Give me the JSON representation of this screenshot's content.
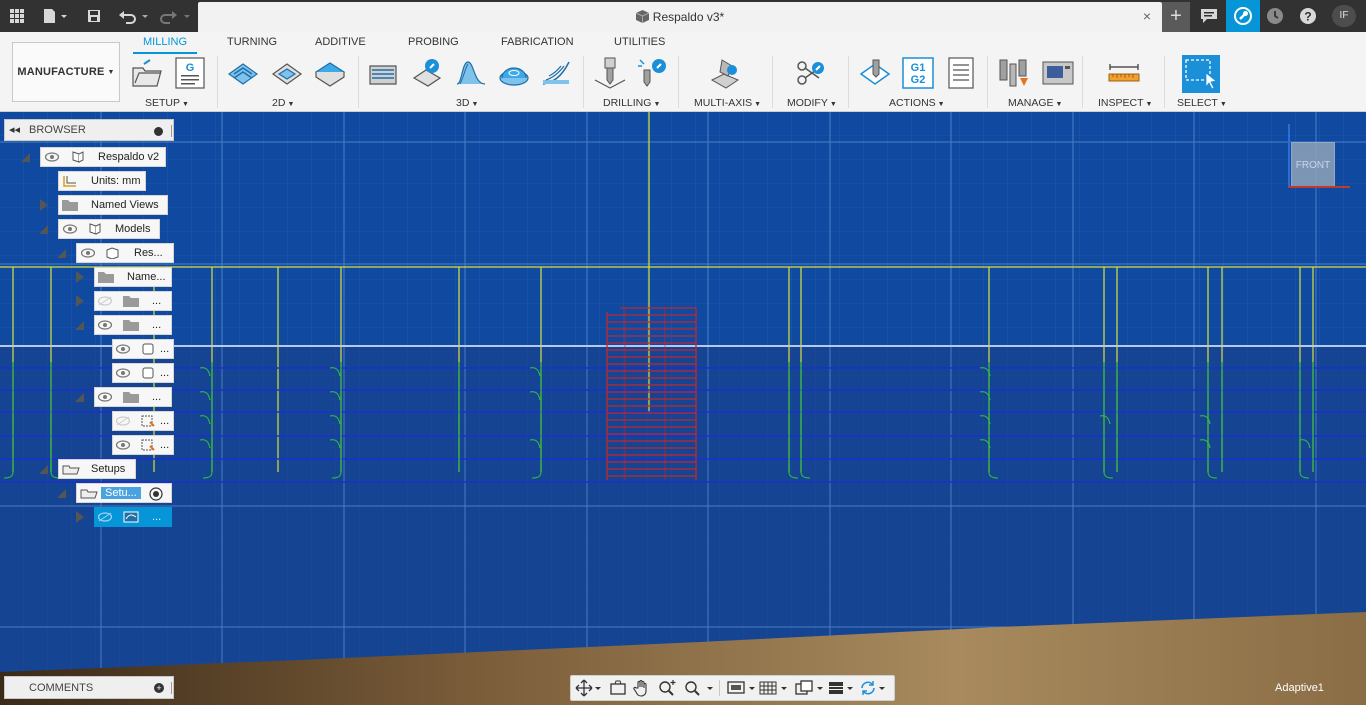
{
  "titlebar": {
    "document_title": "Respaldo v3*",
    "close_tab_glyph": "×",
    "new_tab_glyph": "+",
    "user_initials": "IF",
    "icons": [
      "app-grid-icon",
      "file-icon",
      "save-icon",
      "undo-icon",
      "redo-icon",
      "notifications-icon",
      "active-jobs-icon",
      "history-icon",
      "help-icon"
    ]
  },
  "ribbon": {
    "workspace_label": "MANUFACTURE",
    "tabs": [
      {
        "label": "MILLING",
        "active": true
      },
      {
        "label": "TURNING",
        "active": false
      },
      {
        "label": "ADDITIVE",
        "active": false
      },
      {
        "label": "PROBING",
        "active": false
      },
      {
        "label": "FABRICATION",
        "active": false
      },
      {
        "label": "UTILITIES",
        "active": false
      }
    ],
    "groups": [
      {
        "label": "SETUP",
        "icons": [
          "new-setup-icon",
          "nc-program-icon"
        ]
      },
      {
        "label": "2D",
        "icons": [
          "2d-adaptive-icon",
          "2d-pocket-icon",
          "face-icon"
        ]
      },
      {
        "label": "3D",
        "icons": [
          "3d-adaptive-icon",
          "3d-pocket-icon",
          "steep-shallow-icon",
          "scallop-icon",
          "spiral-icon"
        ]
      },
      {
        "label": "DRILLING",
        "icons": [
          "drill-icon",
          "drill-search-icon"
        ]
      },
      {
        "label": "MULTI-AXIS",
        "icons": [
          "multi-axis-icon"
        ]
      },
      {
        "label": "MODIFY",
        "icons": [
          "modify-scissors-icon"
        ]
      },
      {
        "label": "ACTIONS",
        "icons": [
          "simulate-icon",
          "post-process-icon",
          "setup-sheet-icon"
        ]
      },
      {
        "label": "MANAGE",
        "icons": [
          "tool-library-icon",
          "machine-library-icon"
        ]
      },
      {
        "label": "INSPECT",
        "icons": [
          "measure-icon"
        ]
      },
      {
        "label": "SELECT",
        "icons": [
          "select-window-icon"
        ]
      }
    ],
    "g1g2_text": [
      "G1",
      "G2"
    ],
    "nc_program_letter": "G"
  },
  "browser": {
    "header": "BROWSER",
    "nodes": [
      {
        "label": "Respaldo v2"
      },
      {
        "label": "Units: mm"
      },
      {
        "label": "Named Views"
      },
      {
        "label": "Models"
      },
      {
        "label": "Res..."
      },
      {
        "label": "Name..."
      },
      {
        "label": "..."
      },
      {
        "label": "..."
      },
      {
        "label": "..."
      },
      {
        "label": "..."
      },
      {
        "label": "..."
      },
      {
        "label": "..."
      },
      {
        "label": "..."
      },
      {
        "label": "Setups"
      },
      {
        "label": "Setu..."
      },
      {
        "label": "..."
      }
    ]
  },
  "viewcube": {
    "face_label": "FRONT"
  },
  "comments": {
    "label": "COMMENTS"
  },
  "navbar": {
    "icons": [
      "orbit-pan-icon",
      "look-at-icon",
      "hand-pan-icon",
      "zoom-fit-icon",
      "zoom-window-icon",
      "display-settings-icon",
      "grid-settings-icon",
      "viewports-icon",
      "effects-icon",
      "refresh-icon"
    ]
  },
  "status": {
    "operation_name": "Adaptive1"
  },
  "colors": {
    "titlebar": "#323232",
    "accent": "#0696d7",
    "viewport_bg": "#0f4aa0",
    "stock_outline": "#d8e23a",
    "toolpath_green": "#2fbf3a",
    "toolpath_red": "#c0282d"
  }
}
